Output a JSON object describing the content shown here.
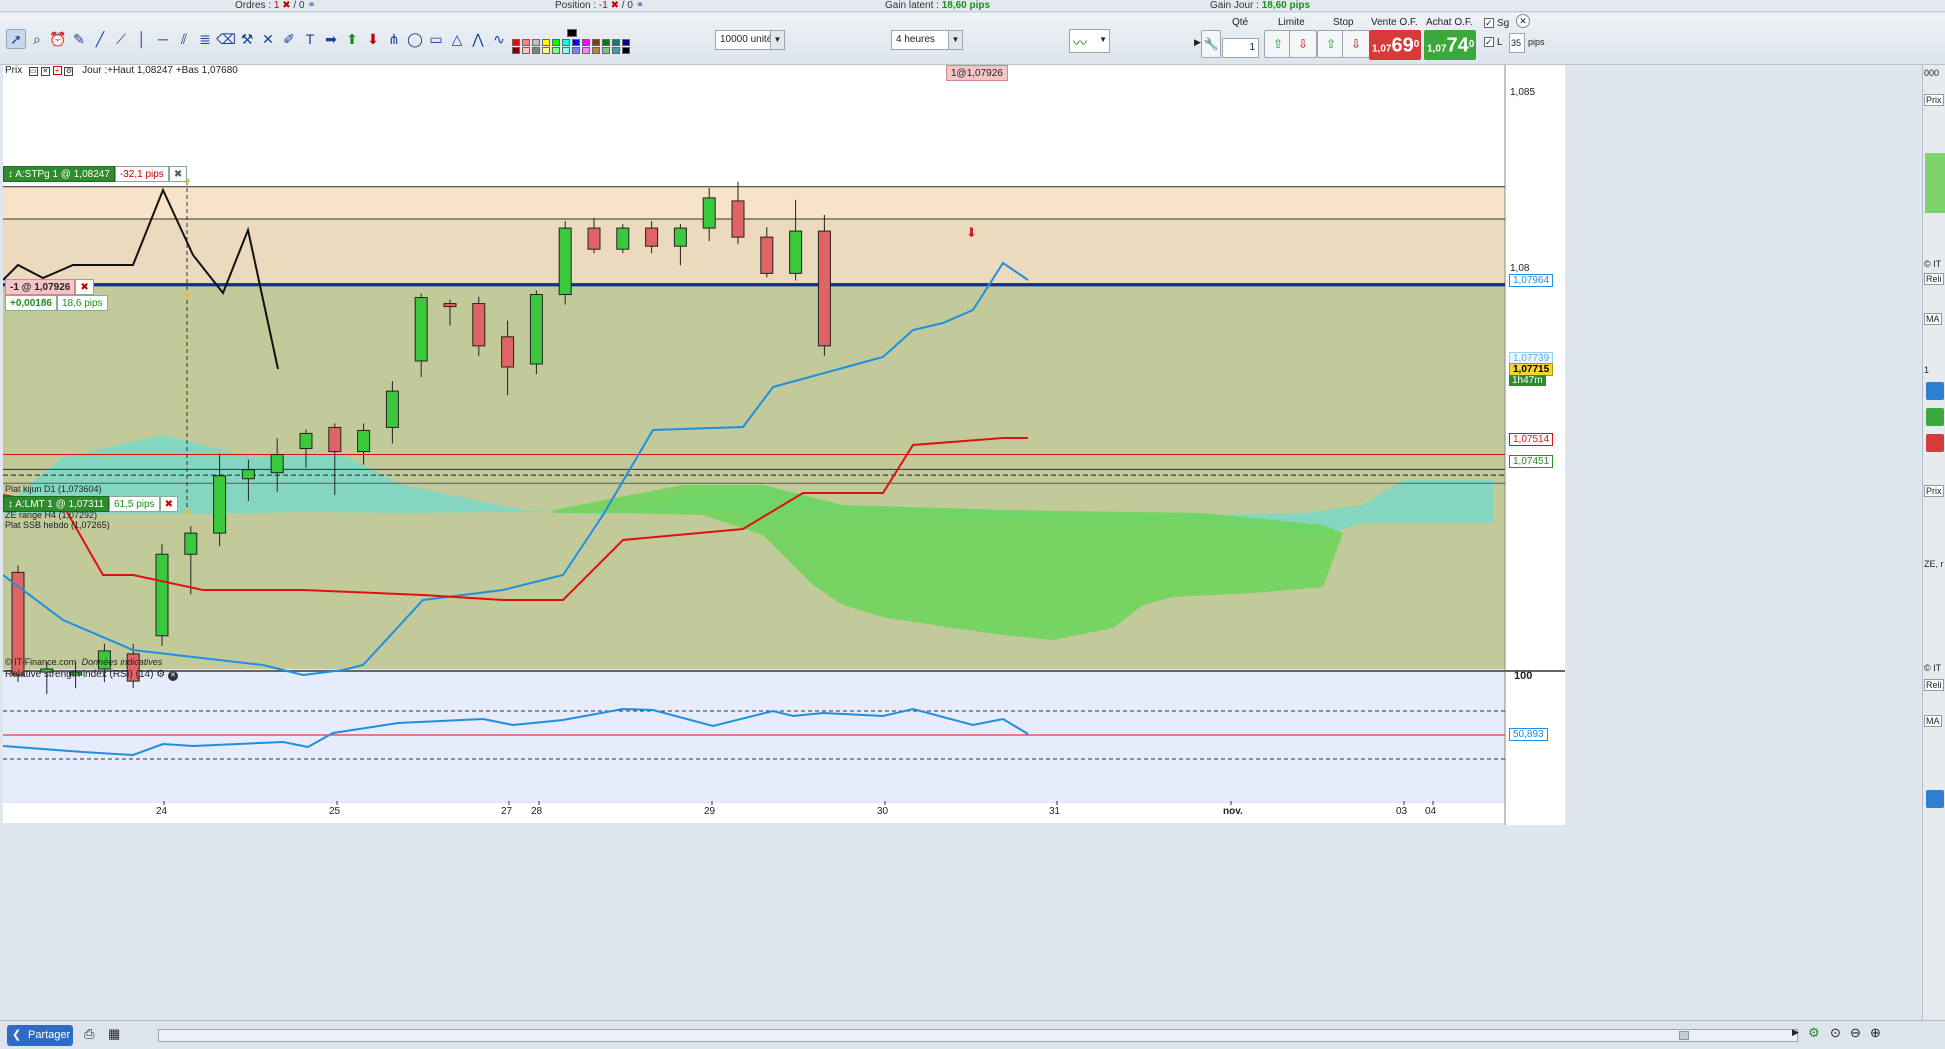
{
  "topbar": {
    "orders_label": "Ordres :",
    "orders_value": "1",
    "orders_sep": "/ 0",
    "position_label": "Position :",
    "position_value": "-1",
    "position_sep": "/ 0",
    "gain_latent_label": "Gain latent :",
    "gain_latent_value": "18,60 pips",
    "gain_jour_label": "Gain Jour :",
    "gain_jour_value": "18,60 pips"
  },
  "toolbar": {
    "quantity_units": "10000 unités",
    "timeframe": "4 heures",
    "qty_label": "Qté",
    "qty_value": "1",
    "limit_label": "Limite",
    "stop_label": "Stop",
    "sell_label": "Vente O.F.",
    "sell_price_small": "1,07",
    "sell_price_big": "69",
    "sell_price_sup": "0",
    "buy_label": "Achat O.F.",
    "buy_price_small": "1,07",
    "buy_price_big": "74",
    "buy_price_sup": "0",
    "sg_label": "Sg",
    "l_label": "L",
    "pips_value": "35",
    "pips_label": "pips"
  },
  "chart_header": {
    "price_label": "Prix",
    "ohlc_text": "Jour :+Haut 1,08247 +Bas 1,07680",
    "position_tag": "1@1,07926"
  },
  "orders": {
    "stop_tag": "A:STPg  1 @ 1,08247",
    "stop_pips": "-32,1 pips",
    "position_tag": "-1 @ 1,07926",
    "position_gain": "+0,00186",
    "position_pips": "18,6 pips",
    "limit_tag": "A:LMT  1 @ 1,07311",
    "limit_pips": "61,5 pips"
  },
  "annotations": {
    "kijun": "Plat kijun D1 (1,073604)",
    "ze": "ZE range H4 (1,07292)",
    "ssb": "Plat SSB hebdo (1,07265)",
    "copyright": "© IT-Finance.com",
    "indicative": "Données indicatives"
  },
  "price_scale": {
    "tick_1085": "1,085",
    "tick_108": "1,08",
    "tag_blue": "1,07964",
    "tag_light": "1,07739",
    "tag_current": "1,07715",
    "tag_timer": "1h47m",
    "tag_red": "1,07514",
    "tag_green": "1,07451"
  },
  "rsi": {
    "title": "Relative strength index (RSI) (14)",
    "scale_top": "100",
    "value_tag": "50,893"
  },
  "time_axis": {
    "labels": [
      "24",
      "25",
      "27",
      "28",
      "29",
      "30",
      "31",
      "nov.",
      "03",
      "04"
    ]
  },
  "bottombar": {
    "share_label": "Partager"
  },
  "right_panel": {
    "items": [
      "000",
      "Prix",
      "© IT",
      "Reli",
      "MA",
      "1",
      "Prix",
      "ZE, r",
      "© IT",
      "Reli",
      "MA"
    ]
  },
  "colors": {
    "bull": "#3cc83c",
    "bear": "#e06464",
    "tenkan": "#1f8fe0",
    "kijun": "#e01010",
    "cloud_bull": "#6fd45c",
    "cloud_bear": "#7ad8c8",
    "bg_green": "#c2ca9a",
    "bg_peach": "#f7e3c8",
    "position_line": "#1030a0"
  },
  "chart_data": {
    "type": "candlestick",
    "timeframe": "4 heures",
    "ylim": [
      1.0665,
      1.0865
    ],
    "yticks": [
      1.085,
      1.08
    ],
    "candles": [
      {
        "o": 1.0697,
        "h": 1.0698,
        "l": 1.0662,
        "c": 1.0663
      },
      {
        "o": 1.0664,
        "h": 1.0666,
        "l": 1.0658,
        "c": 1.0665
      },
      {
        "o": 1.0663,
        "h": 1.0666,
        "l": 1.066,
        "c": 1.0664
      },
      {
        "o": 1.0665,
        "h": 1.0672,
        "l": 1.0662,
        "c": 1.0671
      },
      {
        "o": 1.067,
        "h": 1.0672,
        "l": 1.066,
        "c": 1.0661
      },
      {
        "o": 1.0676,
        "h": 1.0705,
        "l": 1.0674,
        "c": 1.0703
      },
      {
        "o": 1.0703,
        "h": 1.0711,
        "l": 1.0691,
        "c": 1.071
      },
      {
        "o": 1.071,
        "h": 1.0735,
        "l": 1.0707,
        "c": 1.0729
      },
      {
        "o": 1.0728,
        "h": 1.0733,
        "l": 1.0722,
        "c": 1.0731
      },
      {
        "o": 1.073,
        "h": 1.074,
        "l": 1.0725,
        "c": 1.0736
      },
      {
        "o": 1.0738,
        "h": 1.0742,
        "l": 1.0733,
        "c": 1.0743
      },
      {
        "o": 1.0745,
        "h": 1.0737,
        "l": 1.0724,
        "c": 1.0737
      },
      {
        "o": 1.0737,
        "h": 1.0745,
        "l": 1.0734,
        "c": 1.0744
      },
      {
        "o": 1.0745,
        "h": 1.0759,
        "l": 1.0741,
        "c": 1.0757
      },
      {
        "o": 1.0767,
        "h": 1.0782,
        "l": 1.0763,
        "c": 1.0788
      },
      {
        "o": 1.0786,
        "h": 1.0783,
        "l": 1.078,
        "c": 1.0785
      },
      {
        "o": 1.0786,
        "h": 1.0787,
        "l": 1.077,
        "c": 1.0772
      },
      {
        "o": 1.0775,
        "h": 1.0779,
        "l": 1.0757,
        "c": 1.0765
      },
      {
        "o": 1.0766,
        "h": 1.0789,
        "l": 1.0764,
        "c": 1.0789
      },
      {
        "o": 1.0789,
        "h": 1.0812,
        "l": 1.0787,
        "c": 1.0811
      },
      {
        "o": 1.0811,
        "h": 1.0813,
        "l": 1.0807,
        "c": 1.0804
      },
      {
        "o": 1.0804,
        "h": 1.0811,
        "l": 1.0804,
        "c": 1.0811
      },
      {
        "o": 1.0811,
        "h": 1.0812,
        "l": 1.0804,
        "c": 1.0805
      },
      {
        "o": 1.0805,
        "h": 1.0811,
        "l": 1.08,
        "c": 1.0811
      },
      {
        "o": 1.0811,
        "h": 1.0823,
        "l": 1.0808,
        "c": 1.0821
      },
      {
        "o": 1.082,
        "h": 1.0825,
        "l": 1.0807,
        "c": 1.0808
      },
      {
        "o": 1.0808,
        "h": 1.081,
        "l": 1.0796,
        "c": 1.0796
      },
      {
        "o": 1.0796,
        "h": 1.0819,
        "l": 1.0795,
        "c": 1.081
      },
      {
        "o": 1.081,
        "h": 1.0814,
        "l": 1.077,
        "c": 1.0772
      }
    ],
    "levels": [
      {
        "name": "Plat kijun D1",
        "value": 1.073604
      },
      {
        "name": "ZE range H4",
        "value": 1.07292
      },
      {
        "name": "Plat SSB hebdo",
        "value": 1.07265
      },
      {
        "name": "A:STPg",
        "value": 1.08247
      },
      {
        "name": "A:LMT",
        "value": 1.07311
      },
      {
        "name": "Position",
        "value": 1.07926
      }
    ],
    "rsi_last": 50.893
  }
}
